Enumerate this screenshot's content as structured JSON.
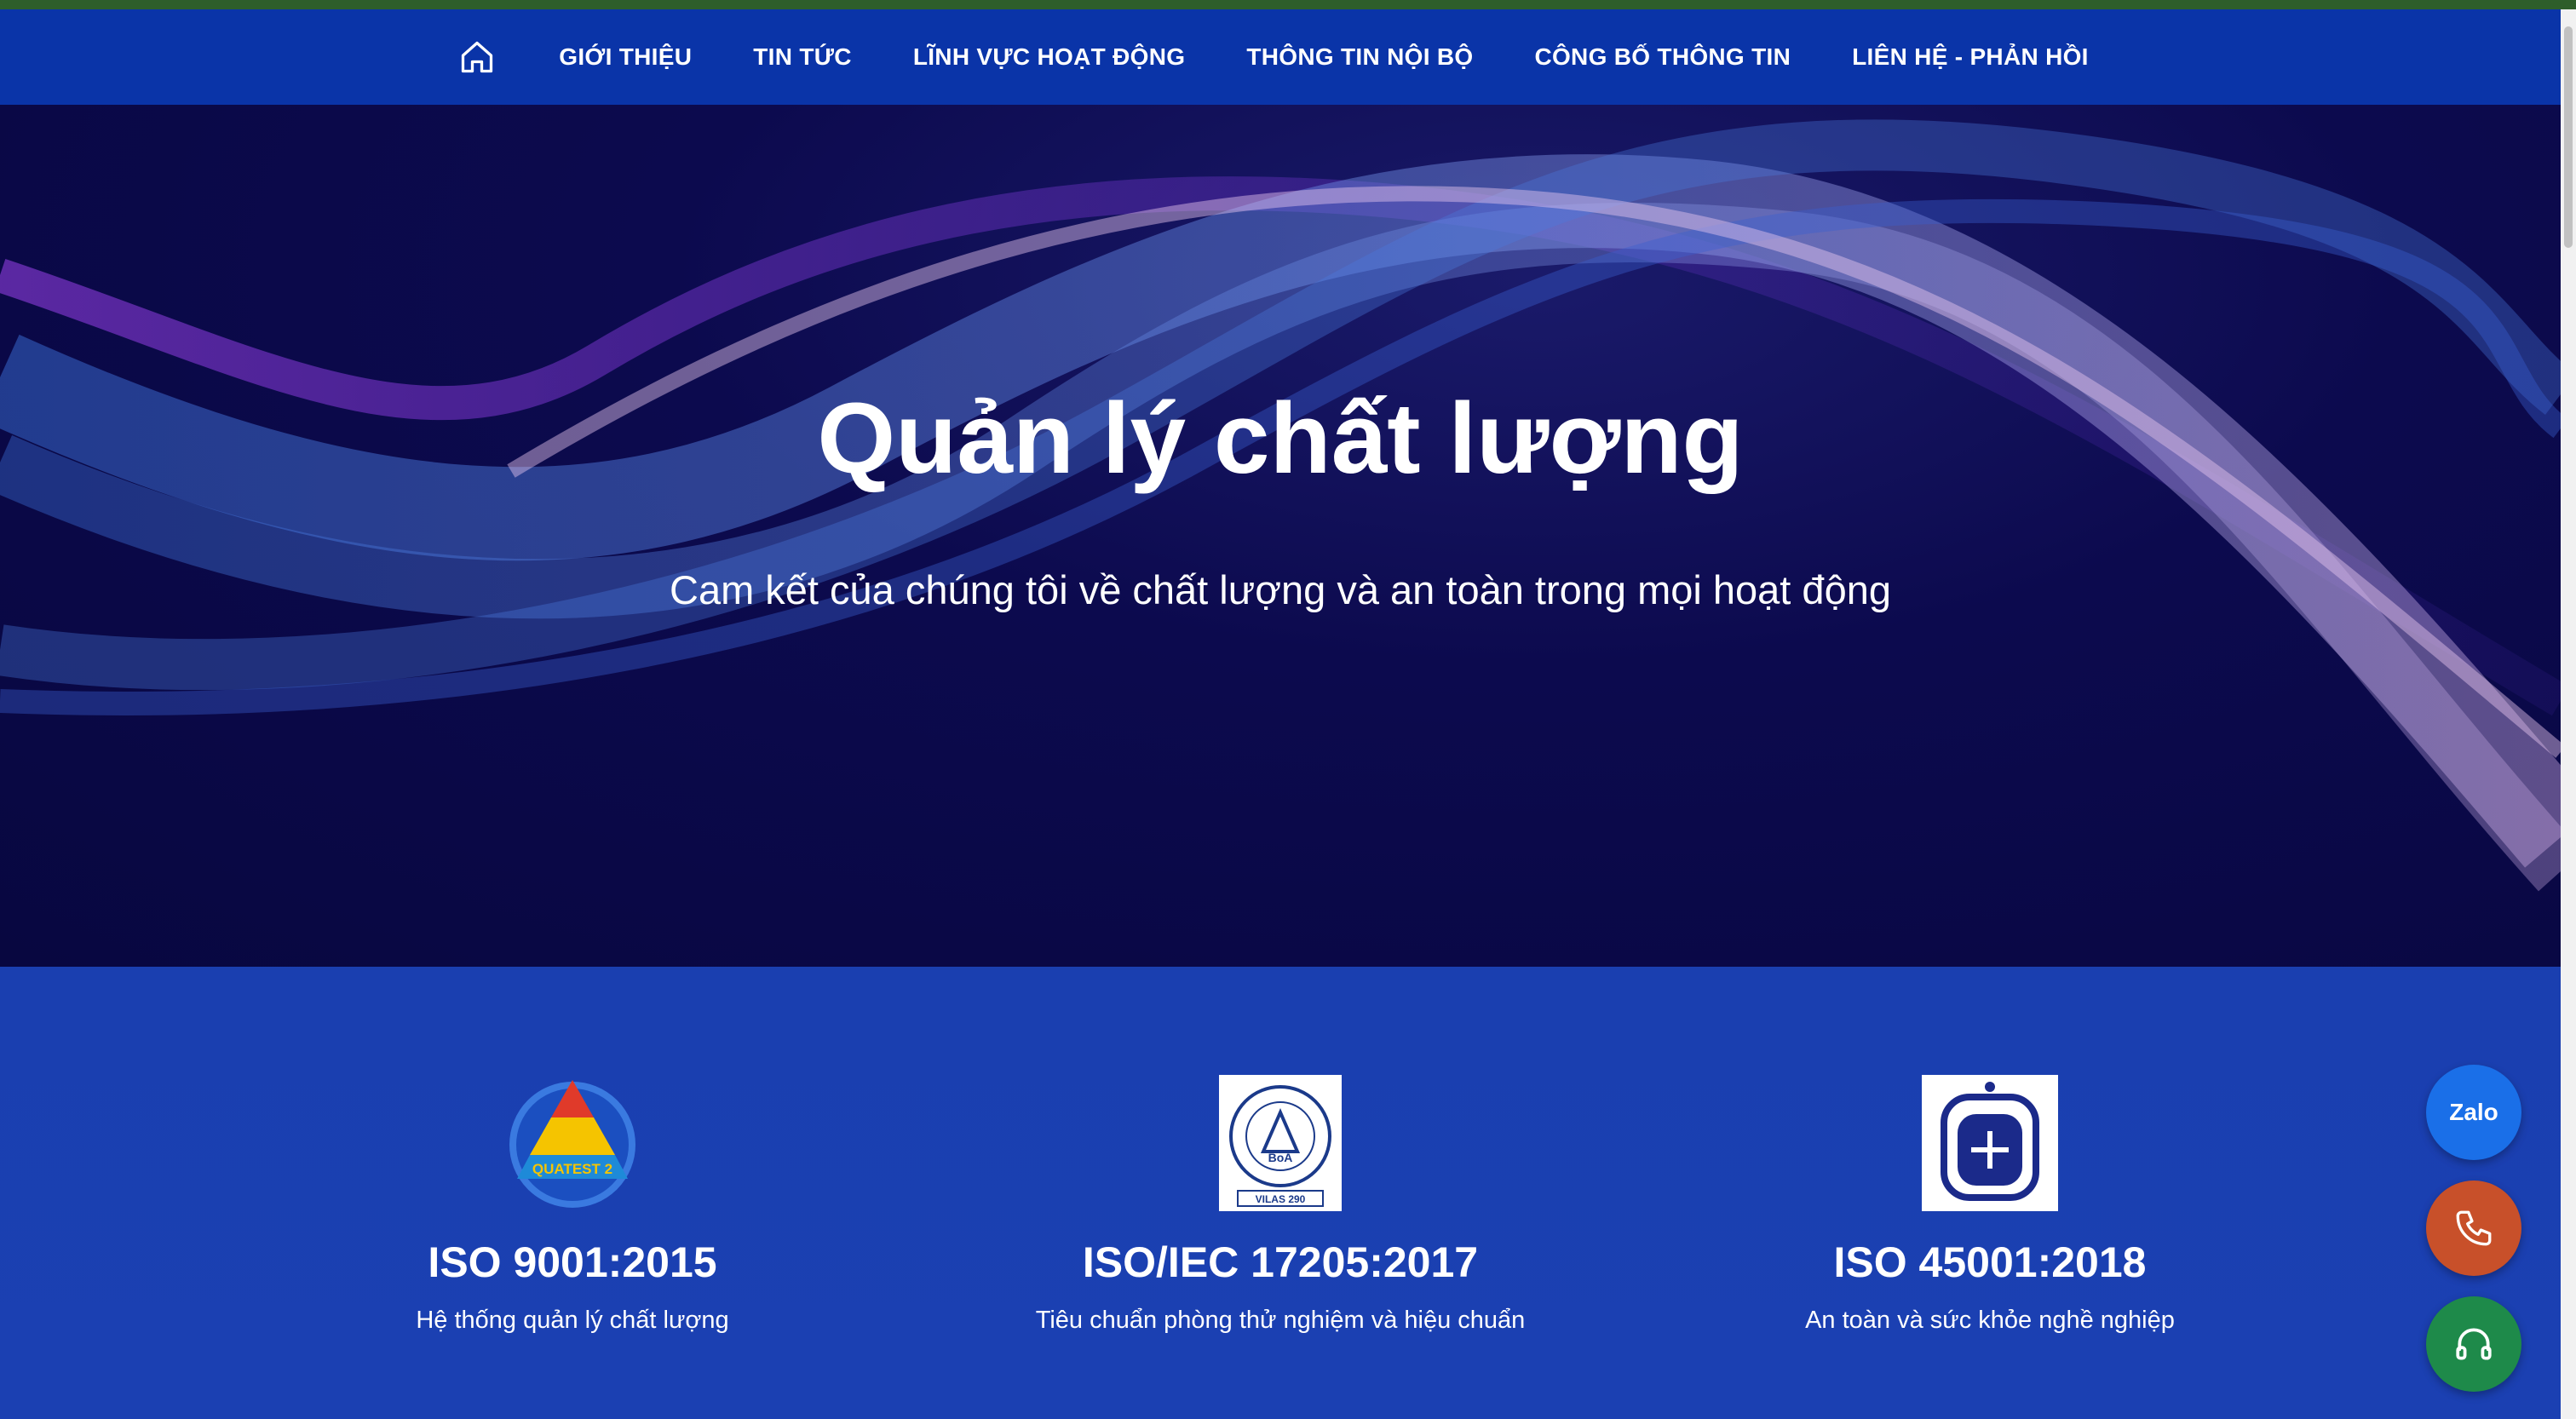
{
  "nav": {
    "items": [
      {
        "label": "GIỚI THIỆU"
      },
      {
        "label": "TIN TỨC"
      },
      {
        "label": "LĨNH VỰC HOẠT ĐỘNG"
      },
      {
        "label": "THÔNG TIN NỘI BỘ"
      },
      {
        "label": "CÔNG BỐ THÔNG TIN"
      },
      {
        "label": "LIÊN HỆ - PHẢN HỒI"
      }
    ],
    "home_icon": "home-icon"
  },
  "hero": {
    "title": "Quản lý chất lượng",
    "subtitle": "Cam kết của chúng tôi về chất lượng và an toàn trong mọi hoạt động"
  },
  "certifications": [
    {
      "title": "ISO 9001:2015",
      "description": "Hệ thống quản lý chất lượng",
      "logo_text": "QUATEST 2"
    },
    {
      "title": "ISO/IEC 17205:2017",
      "description": "Tiêu chuẩn phòng thử nghiệm và hiệu chuẩn",
      "logo_text": "VILAS 290"
    },
    {
      "title": "ISO 45001:2018",
      "description": "An toàn và sức khỏe nghề nghiệp"
    }
  ],
  "floating": {
    "zalo_label": "Zalo",
    "phone_icon": "phone-icon",
    "support_icon": "headset-icon"
  },
  "colors": {
    "top_bar": "#2e5e2a",
    "nav_bg": "#0a34a8",
    "hero_bg": "#0a0848",
    "certs_bg": "#1b40b2",
    "zalo": "#1a6fe8",
    "phone": "#c8502a",
    "support": "#1e8a4a"
  }
}
